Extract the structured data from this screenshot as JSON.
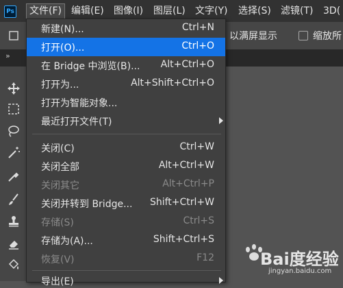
{
  "app": {
    "logo_text": "Ps"
  },
  "menubar": {
    "items": [
      {
        "label": "文件(F)"
      },
      {
        "label": "编辑(E)"
      },
      {
        "label": "图像(I)"
      },
      {
        "label": "图层(L)"
      },
      {
        "label": "文字(Y)"
      },
      {
        "label": "选择(S)"
      },
      {
        "label": "滤镜(T)"
      },
      {
        "label": "3D("
      }
    ]
  },
  "options_bar": {
    "fill_screen_label": "以满屏显示",
    "zoom_all_label": "缩放所",
    "zoom_all_checked": false
  },
  "tabs": {
    "collapse_glyph": "»"
  },
  "file_menu": {
    "items": [
      {
        "label": "新建(N)...",
        "shortcut": "Ctrl+N"
      },
      {
        "label": "打开(O)...",
        "shortcut": "Ctrl+O",
        "highlighted": true
      },
      {
        "label": "在 Bridge 中浏览(B)...",
        "shortcut": "Alt+Ctrl+O"
      },
      {
        "label": "打开为...",
        "shortcut": "Alt+Shift+Ctrl+O"
      },
      {
        "label": "打开为智能对象...",
        "shortcut": ""
      },
      {
        "label": "最近打开文件(T)",
        "shortcut": "",
        "submenu": true
      },
      {
        "label": "关闭(C)",
        "shortcut": "Ctrl+W"
      },
      {
        "label": "关闭全部",
        "shortcut": "Alt+Ctrl+W"
      },
      {
        "label": "关闭其它",
        "shortcut": "Alt+Ctrl+P",
        "disabled": true
      },
      {
        "label": "关闭并转到 Bridge...",
        "shortcut": "Shift+Ctrl+W"
      },
      {
        "label": "存储(S)",
        "shortcut": "Ctrl+S",
        "disabled": true
      },
      {
        "label": "存储为(A)...",
        "shortcut": "Shift+Ctrl+S"
      },
      {
        "label": "恢复(V)",
        "shortcut": "F12",
        "disabled": true
      },
      {
        "label": "导出(E)",
        "shortcut": "",
        "submenu": true
      }
    ]
  },
  "watermark": {
    "brand": "Bai度经验",
    "url": "jingyan.baidu.com"
  },
  "colors": {
    "highlight": "#1473e6",
    "menu_bg": "#404040",
    "bar_bg": "#323232",
    "ps_blue": "#31a8ff"
  }
}
